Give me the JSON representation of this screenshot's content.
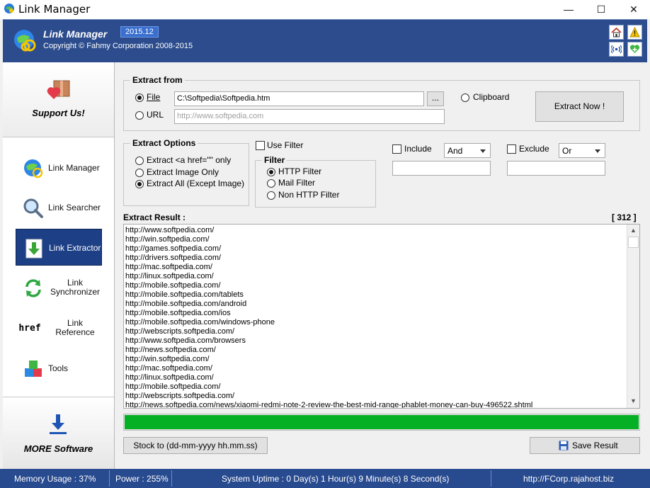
{
  "window": {
    "title": "Link Manager"
  },
  "header": {
    "title": "Link Manager",
    "version": "2015.12",
    "copyright": "Copyright © Fahmy Corporation 2008-2015"
  },
  "sidebar": {
    "support_label": "Support Us!",
    "items": [
      {
        "label": "Link Manager",
        "icon": "globe-link-icon"
      },
      {
        "label": "Link Searcher",
        "icon": "magnifier-icon"
      },
      {
        "label": "Link Extractor",
        "icon": "extract-arrow-icon",
        "active": true
      },
      {
        "label": "Link Synchronizer",
        "icon": "sync-arrows-icon"
      },
      {
        "label": "Link Reference",
        "icon": "href-icon",
        "icon_text": "href"
      },
      {
        "label": "Tools",
        "icon": "cubes-icon"
      }
    ],
    "more_label": "MORE Software"
  },
  "extract_from": {
    "title": "Extract from",
    "file_label": "File",
    "file_value": "C:\\Softpedia\\Softpedia.htm",
    "browse_label": "...",
    "url_label": "URL",
    "url_placeholder": "http://www.softpedia.com",
    "clipboard_label": "Clipboard",
    "extract_now_label": "Extract Now !",
    "selected": "File"
  },
  "extract_options": {
    "title": "Extract Options",
    "options": [
      "Extract <a href=\"\" only",
      "Extract Image Only",
      "Extract All (Except Image)"
    ],
    "selected_index": 2
  },
  "filter": {
    "use_filter_label": "Use Filter",
    "title": "Filter",
    "options": [
      "HTTP Filter",
      "Mail Filter",
      "Non HTTP Filter"
    ],
    "selected_index": 0,
    "include_label": "Include",
    "include_mode": "And",
    "exclude_label": "Exclude",
    "exclude_mode": "Or"
  },
  "result": {
    "label": "Extract Result :",
    "count": "[ 312 ]",
    "lines": [
      "http://www.softpedia.com/",
      "http://win.softpedia.com/",
      "http://games.softpedia.com/",
      "http://drivers.softpedia.com/",
      "http://mac.softpedia.com/",
      "http://linux.softpedia.com/",
      "http://mobile.softpedia.com/",
      "http://mobile.softpedia.com/tablets",
      "http://mobile.softpedia.com/android",
      "http://mobile.softpedia.com/ios",
      "http://mobile.softpedia.com/windows-phone",
      "http://webscripts.softpedia.com/",
      "http://www.softpedia.com/browsers",
      "http://news.softpedia.com/",
      "http://win.softpedia.com/",
      "http://mac.softpedia.com/",
      "http://linux.softpedia.com/",
      "http://mobile.softpedia.com/",
      "http://webscripts.softpedia.com/",
      "http://news.softpedia.com/news/xiaomi-redmi-note-2-review-the-best-mid-range-phablet-money-can-buy-496522.shtml"
    ],
    "progress": 1.0,
    "progress_color": "#06b025"
  },
  "actions": {
    "stock_label": "Stock to (dd-mm-yyyy hh.mm.ss)",
    "save_label": "Save Result"
  },
  "status": {
    "memory": "Memory Usage : 37%",
    "power": "Power : 255%",
    "uptime": "System Uptime : 0 Day(s) 1 Hour(s) 9 Minute(s) 8 Second(s)",
    "url": "http://FCorp.rajahost.biz"
  },
  "colors": {
    "header_bg": "#2c4c8d",
    "status_bg": "#284a8f",
    "active_nav": "#1d3f85"
  }
}
